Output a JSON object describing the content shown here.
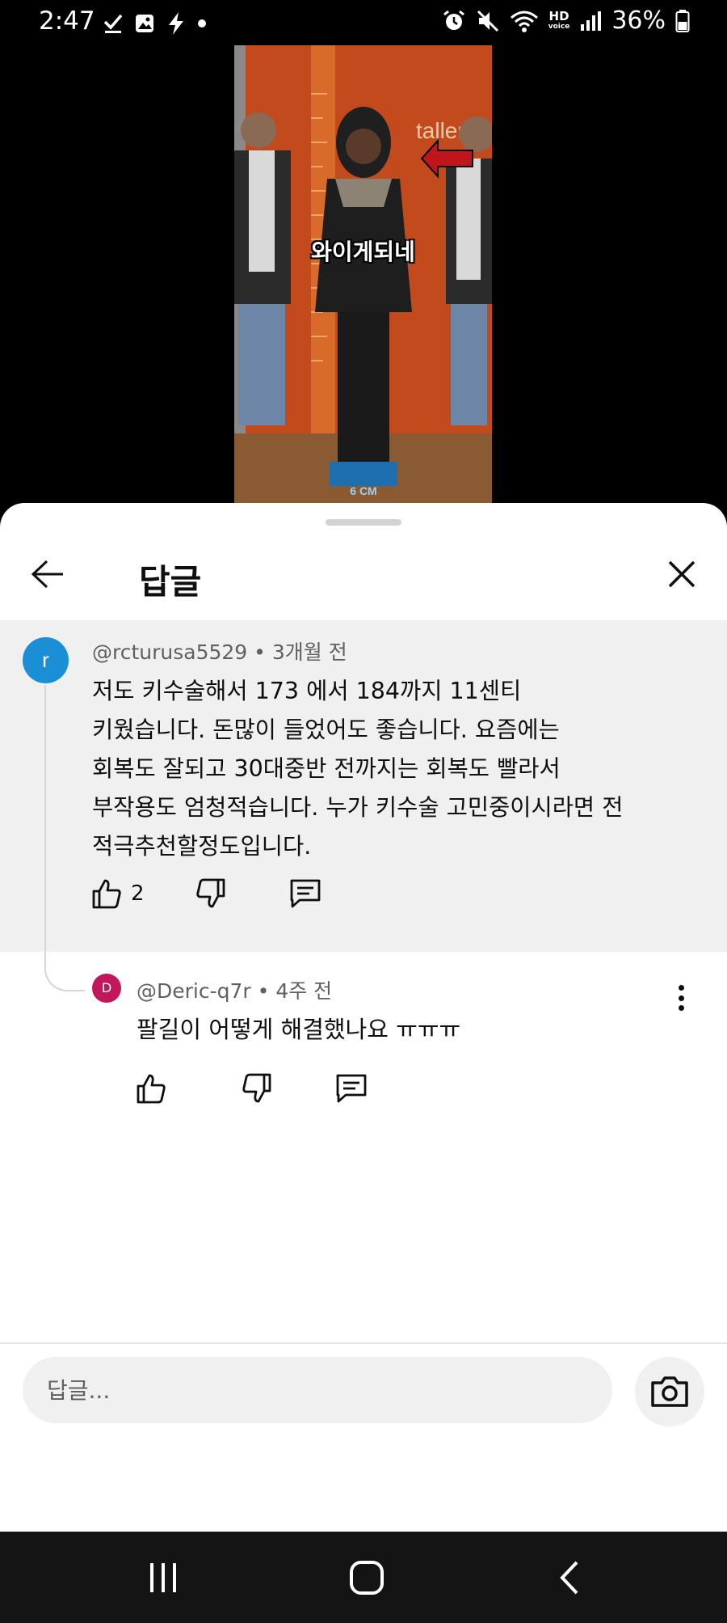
{
  "status_bar": {
    "time": "2:47",
    "battery_percent": "36%",
    "hd_label_top": "HD",
    "hd_label_bottom": "voice",
    "left_icons": [
      "check-icon",
      "gallery-icon",
      "bolt-icon",
      "dot-icon"
    ],
    "right_icons": [
      "alarm-icon",
      "mute-icon",
      "wifi-icon",
      "hd-voice-icon",
      "signal-icon",
      "battery-icon"
    ]
  },
  "video": {
    "caption": "와이게되네",
    "wall_text": "taller",
    "scale_text": "6 CM"
  },
  "header": {
    "title": "답글",
    "back_icon": "arrow-left-icon",
    "close_icon": "close-icon"
  },
  "parent_comment": {
    "avatar_letter": "r",
    "avatar_color": "#1a8fd6",
    "author": "@rcturusa5529",
    "time": "3개월 전",
    "meta_separator": " • ",
    "text_lines": [
      "저도 키수술해서 173 에서 184까지 11센티",
      "키웠습니다. 돈많이 들었어도 좋습니다. 요즘에는",
      "회복도 잘되고 30대중반 전까지는 회복도 빨라서",
      "부작용도 엄청적습니다. 누가 키수술 고민중이시라면 전",
      "적극추천할정도입니다."
    ],
    "like_count": "2"
  },
  "reply": {
    "avatar_letter": "D",
    "avatar_color": "#c2185b",
    "author": "@Deric-q7r",
    "time": "4주 전",
    "meta_separator": " • ",
    "text": "팔길이 어떻게 해결했나요 ㅠㅠㅠ"
  },
  "input": {
    "placeholder": "답글..."
  },
  "nav": {
    "icons": [
      "recent-apps-icon",
      "home-icon",
      "back-nav-icon"
    ]
  }
}
